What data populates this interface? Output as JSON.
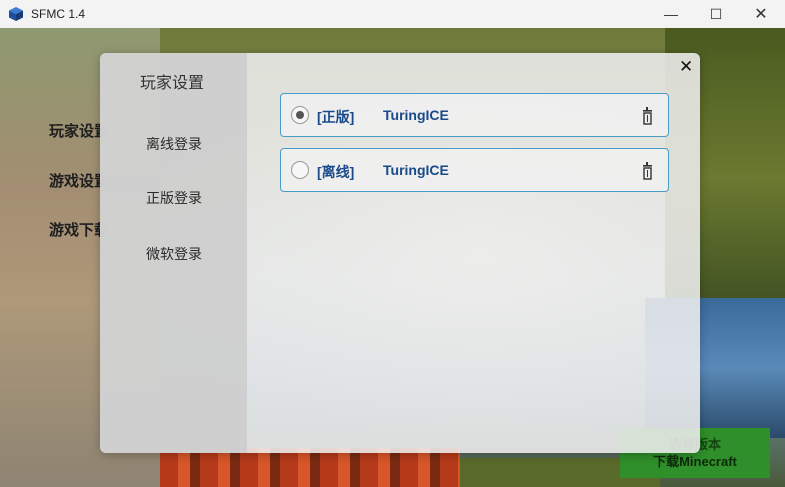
{
  "window": {
    "title": "SFMC 1.4",
    "minimize_glyph": "—",
    "maximize_glyph": "☐",
    "close_glyph": "✕"
  },
  "side_nav": {
    "items": [
      {
        "label": "玩家设置"
      },
      {
        "label": "游戏设置"
      },
      {
        "label": "游戏下载"
      }
    ]
  },
  "download": {
    "line1": "选择版本",
    "line2": "下载Minecraft"
  },
  "dialog": {
    "title": "玩家设置",
    "close_glyph": "✕",
    "menu": [
      {
        "label": "离线登录"
      },
      {
        "label": "正版登录"
      },
      {
        "label": "微软登录"
      }
    ],
    "accounts": [
      {
        "type": "[正版]",
        "name": "TuringICE",
        "selected": true
      },
      {
        "type": "[离线]",
        "name": "TuringICE",
        "selected": false
      }
    ]
  },
  "icons": {
    "app": "minecraft-cube-icon",
    "delete": "trash-icon"
  },
  "colors": {
    "accent_border": "#4a9cc8",
    "account_text": "#1a4a8a",
    "download_green": "#2f8f2a"
  }
}
